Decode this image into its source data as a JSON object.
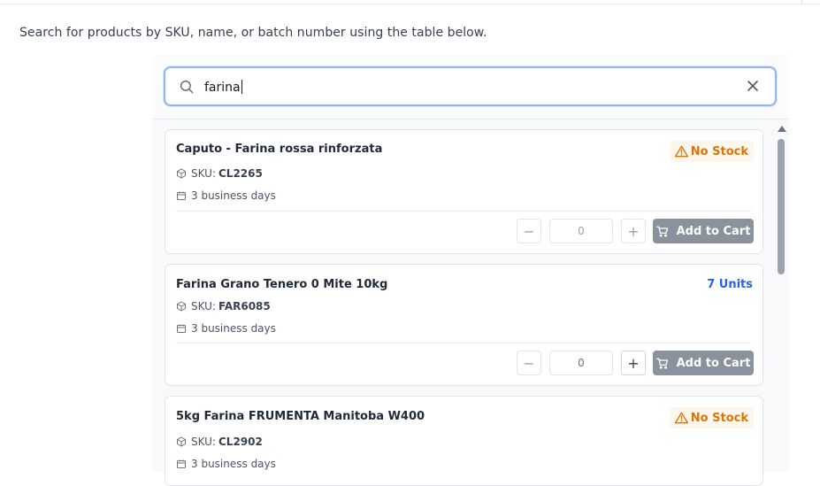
{
  "description": "Search for products by SKU, name, or batch number using the table below.",
  "search": {
    "value": "farina"
  },
  "labels": {
    "sku_prefix": "SKU:",
    "add_to_cart": "Add to Cart",
    "minus": "−",
    "plus": "+"
  },
  "products": [
    {
      "name": "Caputo - Farina rossa rinforzata",
      "sku": "CL2265",
      "delivery": "3 business days",
      "stock": "No Stock",
      "in_stock": false,
      "quantity": "0"
    },
    {
      "name": "Farina Grano Tenero 0 Mite 10kg",
      "sku": "FAR6085",
      "delivery": "3 business days",
      "stock": "7 Units",
      "in_stock": true,
      "quantity": "0"
    },
    {
      "name": "5kg Farina FRUMENTA Manitoba W400",
      "sku": "CL2902",
      "delivery": "3 business days",
      "stock": "No Stock",
      "in_stock": false,
      "quantity": null
    }
  ],
  "colors": {
    "accent": "#2563eb",
    "warning": "#d97706",
    "button": "#8a929e",
    "focus_border": "#93b4ec"
  }
}
